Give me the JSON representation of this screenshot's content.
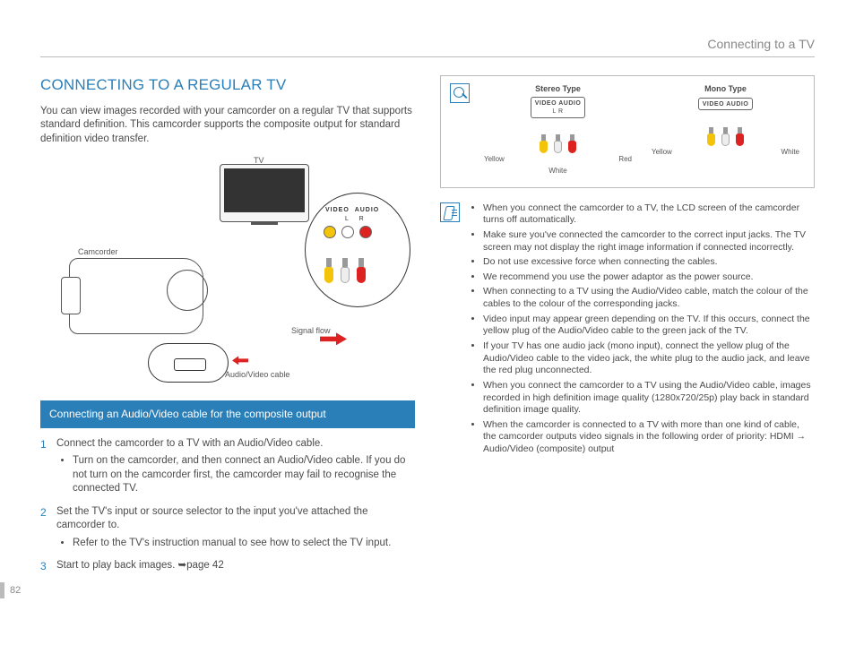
{
  "breadcrumb": "Connecting to a TV",
  "page_number": "82",
  "section_title": "CONNECTING TO A REGULAR TV",
  "intro_text": "You can view images recorded with your camcorder on a regular TV that supports standard definition. This camcorder supports the composite output for standard definition video transfer.",
  "diagram": {
    "tv_label": "TV",
    "camcorder_label": "Camcorder",
    "signal_flow_label": "Signal flow",
    "av_cable_label": "Audio/Video cable",
    "ports_video": "VIDEO",
    "ports_audio": "AUDIO",
    "ports_l": "L",
    "ports_r": "R"
  },
  "subsection_title": "Connecting an Audio/Video cable for the composite output",
  "steps": {
    "s1": "Connect the camcorder to a TV with an Audio/Video cable.",
    "s1_sub1": "Turn on the camcorder, and then connect an Audio/Video cable. If you do not turn on the camcorder first, the camcorder may fail to recognise the connected TV.",
    "s2": "Set the TV's input or source selector to the input you've attached the camcorder to.",
    "s2_sub1": "Refer to the TV's instruction manual to see how to select the TV input.",
    "s3_prefix": "Start to play back images. ",
    "s3_ref": "page 42"
  },
  "connection_types": {
    "stereo": {
      "title": "Stereo Type",
      "panel": "VIDEO   AUDIO",
      "sub": "L       R",
      "label_yellow": "Yellow",
      "label_white": "White",
      "label_red": "Red"
    },
    "mono": {
      "title": "Mono Type",
      "panel": "VIDEO   AUDIO",
      "label_yellow": "Yellow",
      "label_white": "White"
    }
  },
  "notes": {
    "n1": "When you connect the camcorder to a TV, the LCD screen of the camcorder turns off automatically.",
    "n2": "Make sure you've connected the camcorder to the correct input jacks. The TV screen may not display the right image information if connected incorrectly.",
    "n3": "Do not use excessive force when connecting the cables.",
    "n4": "We recommend you use the power adaptor as the power source.",
    "n5": "When connecting to a TV using the Audio/Video cable, match the colour of the cables to the colour of the corresponding jacks.",
    "n6": "Video input may appear green depending on the TV. If this occurs, connect the yellow plug of the Audio/Video cable to the green jack of the TV.",
    "n7": "If your TV has one audio jack (mono input), connect the yellow plug of the Audio/Video cable to the video jack, the white plug to the audio jack, and leave the red plug unconnected.",
    "n8": "When you connect the camcorder to a TV using the Audio/Video cable, images recorded in high definition image quality (1280x720/25p) play back in standard definition image quality.",
    "n9_prefix": "When the camcorder is connected to a TV with more than one kind of cable, the camcorder outputs video signals in the following order of priority: HDMI ",
    "n9_suffix": " Audio/Video (composite) output"
  }
}
